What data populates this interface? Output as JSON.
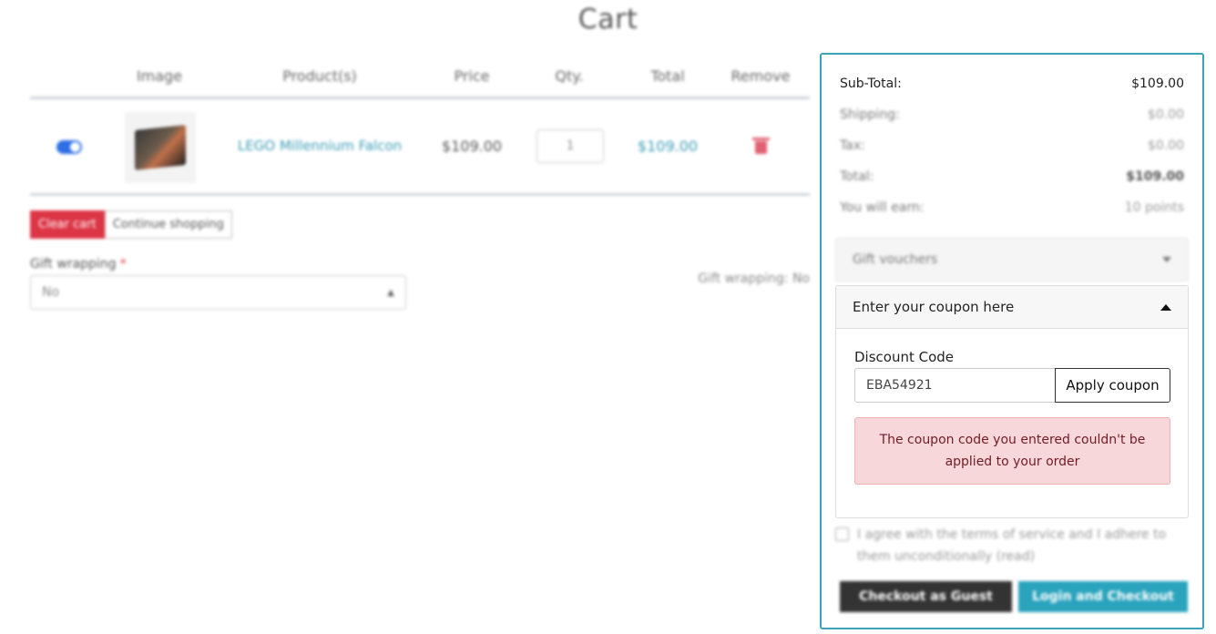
{
  "page": {
    "title": "Cart"
  },
  "table": {
    "headers": [
      "Image",
      "Product(s)",
      "Price",
      "Qty.",
      "Total",
      "Remove"
    ],
    "rows": [
      {
        "selected": true,
        "product": "LEGO Millennium Falcon",
        "price": "$109.00",
        "qty": "1",
        "total": "$109.00"
      }
    ]
  },
  "actions": {
    "clear_cart": "Clear cart",
    "continue_shopping": "Continue shopping"
  },
  "gift_wrapping": {
    "label": "Gift wrapping",
    "required_mark": "*",
    "selected": "No",
    "status": "Gift wrapping: No"
  },
  "summary": {
    "subtotal_label": "Sub-Total:",
    "subtotal_value": "$109.00",
    "shipping_label": "Shipping:",
    "shipping_value": "$0.00",
    "tax_label": "Tax:",
    "tax_value": "$0.00",
    "total_label": "Total:",
    "total_value": "$109.00",
    "earn_label": "You will earn:",
    "earn_value": "10 points"
  },
  "gift_vouchers": {
    "label": "Gift vouchers"
  },
  "coupon": {
    "header": "Enter your coupon here",
    "field_label": "Discount Code",
    "value": "EBA54921",
    "apply_label": "Apply coupon",
    "error": "The coupon code you entered couldn't be applied to your order"
  },
  "terms": {
    "text": "I agree with the terms of service and I adhere to them unconditionally (read)"
  },
  "checkout": {
    "guest_label": "Checkout as Guest",
    "login_label": "Login and Checkout"
  },
  "colors": {
    "accent": "#3ba3b8",
    "danger": "#dc3545",
    "alert_bg": "#f8d7da"
  }
}
